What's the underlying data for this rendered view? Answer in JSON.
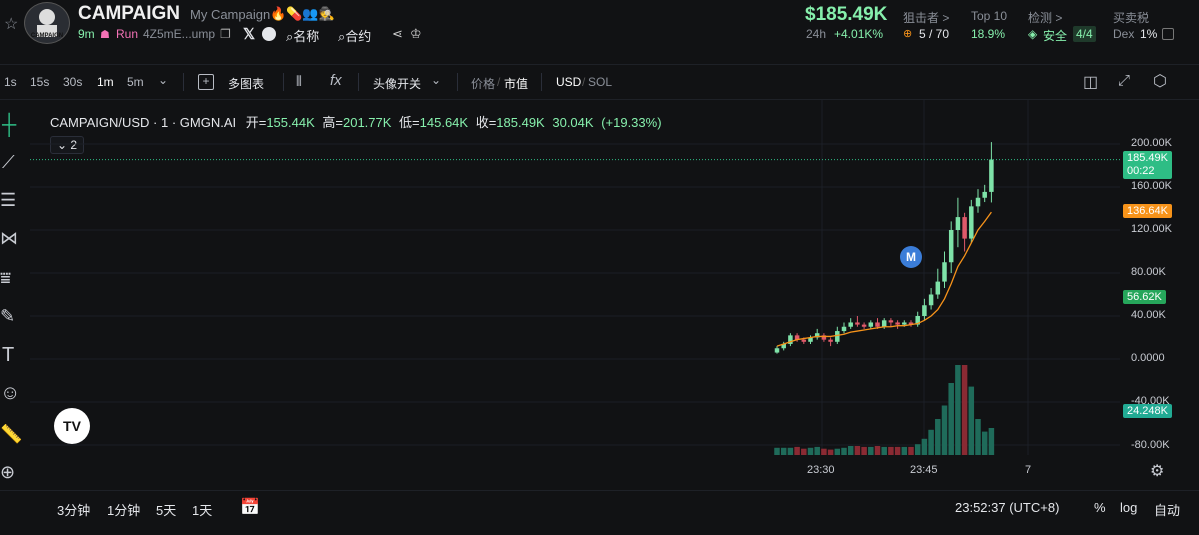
{
  "header": {
    "token_name": "CAMPAIGN",
    "token_subtitle": "My Campaign",
    "avatar_text": "CAMPAIGN 2028",
    "age": "9m",
    "run_label": "Run",
    "address": "4Z5mE...ump",
    "name_search": "名称",
    "contract_search": "合约",
    "price": "$185.49K",
    "change_label": "24h",
    "change_value": "+4.01K%",
    "sniper_label": "狙击者 >",
    "sniper_value": "5 / 70",
    "top10_label": "Top 10",
    "top10_value": "18.9%",
    "detect_label": "检测 >",
    "detect_value": "安全",
    "detect_badge": "4/4",
    "tax_label": "买卖税",
    "tax_dex": "Dex",
    "tax_value": "1%"
  },
  "toolbar": {
    "intervals": [
      "1s",
      "15s",
      "30s",
      "1m",
      "5m"
    ],
    "active_interval": "1m",
    "multi_chart": "多图表",
    "avatar_toggle": "头像开关",
    "price_label": "价格",
    "mcap_label": "市值",
    "usd": "USD",
    "sol": "SOL"
  },
  "chart": {
    "legend_title": "CAMPAIGN/USD · 1 · GMGN.AI",
    "open_label": "开=",
    "open_value": "155.44K",
    "high_label": "高=",
    "high_value": "201.77K",
    "low_label": "低=",
    "low_value": "145.64K",
    "close_label": "收=",
    "close_value": "185.49K",
    "volume_value": "30.04K",
    "change_value": "(+19.33%)",
    "indicator_count": "2",
    "marker_letter": "M",
    "y_ticks": [
      "200.00K",
      "160.00K",
      "120.00K",
      "80.00K",
      "40.00K",
      "0.0000",
      "-40.00K",
      "-80.00K"
    ],
    "x_ticks": [
      "23:30",
      "23:45",
      "7"
    ],
    "current_price": "185.49K",
    "countdown": "00:22",
    "ma_price": "136.64K",
    "low_marker_price": "56.62K",
    "volume_tag": "24.248K",
    "colors": {
      "up": "#2ebd85",
      "down": "#f23645",
      "orange": "#f7931a",
      "teal": "#22ab94",
      "marker": "#2962ff"
    }
  },
  "chart_data": {
    "type": "candlestick",
    "x_labels": [
      "23:30",
      "23:45"
    ],
    "ylim": [
      -80000,
      200000
    ],
    "candles": [
      {
        "o": 6000,
        "c": 10000,
        "h": 12000,
        "l": 5000
      },
      {
        "o": 10000,
        "c": 14000,
        "h": 16000,
        "l": 8000
      },
      {
        "o": 14000,
        "c": 22000,
        "h": 24000,
        "l": 12000
      },
      {
        "o": 22000,
        "c": 18000,
        "h": 24000,
        "l": 16000
      },
      {
        "o": 18000,
        "c": 16000,
        "h": 20000,
        "l": 14000
      },
      {
        "o": 16000,
        "c": 20000,
        "h": 22000,
        "l": 14000
      },
      {
        "o": 20000,
        "c": 24000,
        "h": 28000,
        "l": 18000
      },
      {
        "o": 22000,
        "c": 18000,
        "h": 24000,
        "l": 16000
      },
      {
        "o": 18000,
        "c": 16000,
        "h": 20000,
        "l": 12000
      },
      {
        "o": 16000,
        "c": 26000,
        "h": 30000,
        "l": 14000
      },
      {
        "o": 26000,
        "c": 30000,
        "h": 34000,
        "l": 24000
      },
      {
        "o": 30000,
        "c": 34000,
        "h": 38000,
        "l": 28000
      },
      {
        "o": 34000,
        "c": 32000,
        "h": 40000,
        "l": 30000
      },
      {
        "o": 32000,
        "c": 30000,
        "h": 34000,
        "l": 28000
      },
      {
        "o": 30000,
        "c": 34000,
        "h": 36000,
        "l": 28000
      },
      {
        "o": 34000,
        "c": 30000,
        "h": 38000,
        "l": 28000
      },
      {
        "o": 30000,
        "c": 36000,
        "h": 38000,
        "l": 28000
      },
      {
        "o": 36000,
        "c": 34000,
        "h": 38000,
        "l": 30000
      },
      {
        "o": 34000,
        "c": 32000,
        "h": 36000,
        "l": 28000
      },
      {
        "o": 32000,
        "c": 34000,
        "h": 36000,
        "l": 30000
      },
      {
        "o": 34000,
        "c": 32000,
        "h": 36000,
        "l": 30000
      },
      {
        "o": 32000,
        "c": 40000,
        "h": 44000,
        "l": 30000
      },
      {
        "o": 40000,
        "c": 50000,
        "h": 56000,
        "l": 36000
      },
      {
        "o": 50000,
        "c": 60000,
        "h": 66000,
        "l": 46000
      },
      {
        "o": 60000,
        "c": 72000,
        "h": 84000,
        "l": 56000
      },
      {
        "o": 72000,
        "c": 90000,
        "h": 100000,
        "l": 66000
      },
      {
        "o": 90000,
        "c": 120000,
        "h": 128000,
        "l": 80000
      },
      {
        "o": 120000,
        "c": 132000,
        "h": 150000,
        "l": 104000
      },
      {
        "o": 132000,
        "c": 112000,
        "h": 136000,
        "l": 100000
      },
      {
        "o": 112000,
        "c": 142000,
        "h": 148000,
        "l": 108000
      },
      {
        "o": 142000,
        "c": 150000,
        "h": 158000,
        "l": 136000
      },
      {
        "o": 150000,
        "c": 155440,
        "h": 162000,
        "l": 146000
      },
      {
        "o": 155440,
        "c": 185490,
        "h": 201770,
        "l": 145640
      }
    ],
    "ma_line": [
      12000,
      14000,
      16000,
      18000,
      19000,
      20000,
      21000,
      21000,
      21000,
      22000,
      23000,
      25000,
      26000,
      27000,
      28000,
      29000,
      30000,
      30000,
      31000,
      31000,
      32000,
      33000,
      36000,
      40000,
      46000,
      56000,
      70000,
      86000,
      96000,
      108000,
      120000,
      128000,
      136640
    ],
    "volumes": [
      8,
      8,
      8,
      9,
      7,
      8,
      9,
      7,
      6,
      7,
      8,
      10,
      10,
      9,
      9,
      10,
      9,
      9,
      9,
      9,
      9,
      12,
      18,
      28,
      40,
      55,
      80,
      100,
      100,
      76,
      40,
      26,
      30
    ]
  }
}
